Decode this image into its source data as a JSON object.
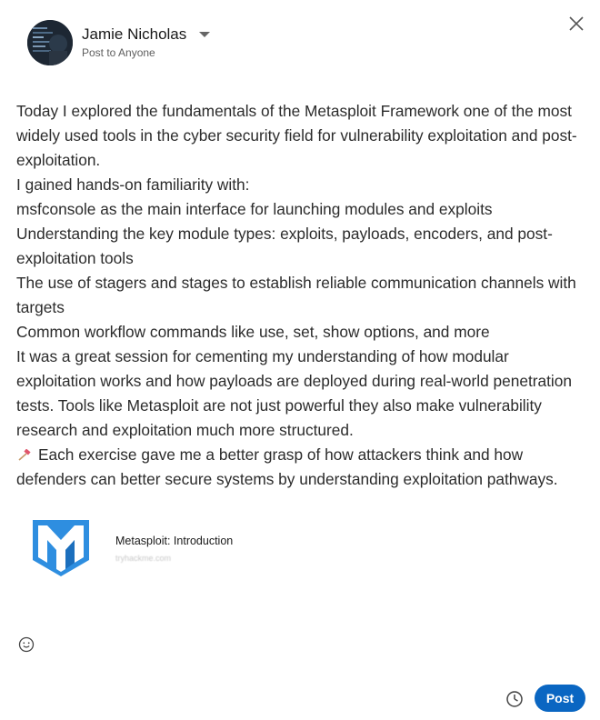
{
  "author": {
    "name": "Jamie Nicholas",
    "visibility": "Post to Anyone"
  },
  "post": {
    "paragraphs": [
      "Today I explored the fundamentals of the Metasploit Framework one of the most widely used tools in the cyber security field for vulnerability exploitation and post-exploitation.",
      "I gained hands-on familiarity with:",
      "msfconsole as the main interface for launching modules and exploits",
      "Understanding the key module types: exploits, payloads, encoders, and post-exploitation tools",
      "The use of stagers and stages to establish reliable communication channels with targets",
      "Common workflow commands like use, set, show options, and more",
      "It was a great session for cementing my understanding of how modular exploitation works and how payloads are deployed during real-world penetration tests. Tools like Metasploit are not just powerful they also make vulnerability research and exploitation much more structured."
    ],
    "closing": "Each exercise gave me a better grasp of how attackers think and how defenders can better secure systems by understanding exploitation pathways."
  },
  "link_preview": {
    "title": "Metasploit: Introduction",
    "domain": "tryhackme.com"
  },
  "actions": {
    "post_label": "Post"
  },
  "icons": {
    "close": "close-icon",
    "emoji": "emoji-icon",
    "schedule": "clock-icon",
    "closing_emoji": "hammer-icon"
  },
  "colors": {
    "post_button": "#0a66c2",
    "link_logo": "#2e8ee0"
  }
}
